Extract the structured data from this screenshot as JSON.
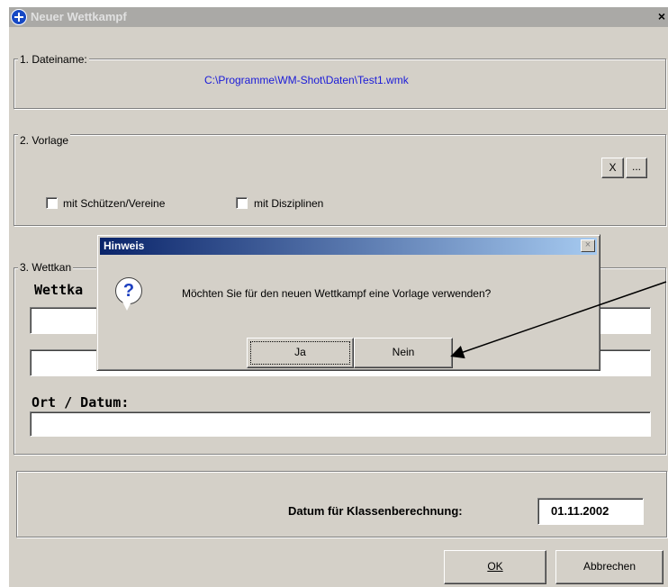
{
  "window": {
    "title": "Neuer Wettkampf",
    "close": "×"
  },
  "group_file": {
    "label": "1. Dateiname:",
    "path": "C:\\Programme\\WM-Shot\\Daten\\Test1.wmk"
  },
  "group_template": {
    "label": "2. Vorlage",
    "clear_button": "X",
    "browse_button": "...",
    "check_shooters": "mit Schützen/Vereine",
    "check_disciplines": "mit Disziplinen"
  },
  "group_competition": {
    "label": "3. Wettkan",
    "name_label": "Wettka",
    "location_label": "Ort / Datum:"
  },
  "class_date": {
    "label": "Datum für Klassenberechnung:",
    "value": "01.11.2002"
  },
  "buttons": {
    "ok": "OK",
    "cancel": "Abbrechen"
  },
  "dialog": {
    "title": "Hinweis",
    "close": "×",
    "message": "Möchten Sie für den neuen Wettkampf eine Vorlage verwenden?",
    "yes": "Ja",
    "no": "Nein",
    "icon": "question-icon"
  }
}
